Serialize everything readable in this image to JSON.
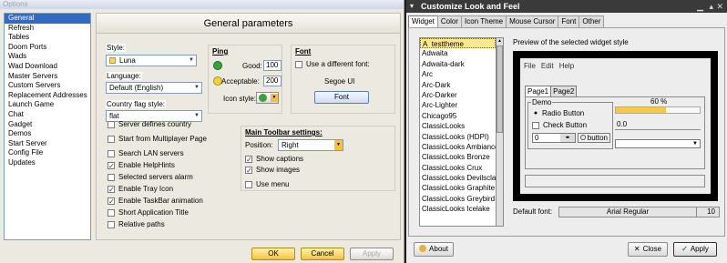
{
  "options_window": {
    "title": "Options",
    "nav_items": [
      "General",
      "Refresh",
      "Tables",
      "Doom Ports",
      "Wads",
      "Wad Download",
      "Master Servers",
      "Custom Servers",
      "Replacement Addresses",
      "Launch Game",
      "Chat",
      "Gadget",
      "Demos",
      "Start Server",
      "Config File",
      "Updates"
    ],
    "selected_nav": 0,
    "header": "General parameters",
    "style_label": "Style:",
    "style_value": "Luna",
    "language_label": "Language:",
    "language_value": "Default (English)",
    "country_flag_label": "Country flag style:",
    "country_flag_value": "flat",
    "checkboxes": [
      {
        "label": "Server defines country",
        "checked": false
      },
      {
        "label": "Start from Multiplayer Page",
        "checked": false
      },
      {
        "label": "Search LAN servers",
        "checked": false
      },
      {
        "label": "Enable HelpHints",
        "checked": true
      },
      {
        "label": "Selected servers alarm",
        "checked": false
      },
      {
        "label": "Enable Tray Icon",
        "checked": true
      },
      {
        "label": "Enable TaskBar animation",
        "checked": true
      },
      {
        "label": "Short Application Title",
        "checked": false
      },
      {
        "label": "Relative paths",
        "checked": false
      }
    ],
    "ping": {
      "title": "Ping",
      "good_label": "Good:",
      "good_value": "100",
      "acceptable_label": "Acceptable:",
      "acceptable_value": "200",
      "icon_style_label": "Icon style:"
    },
    "font": {
      "title": "Font",
      "use_different_label": "Use a different font:",
      "font_name": "Segoe UI",
      "button": "Font"
    },
    "toolbar": {
      "title": "Main Toolbar settings:",
      "position_label": "Position:",
      "position_value": "Right",
      "show_captions": "Show captions",
      "show_images": "Show images",
      "use_menu": "Use menu"
    },
    "buttons": {
      "ok": "OK",
      "cancel": "Cancel",
      "apply": "Apply"
    }
  },
  "customize_window": {
    "title": "Customize Look and Feel",
    "tabs": [
      "Widget",
      "Color",
      "Icon Theme",
      "Mouse Cursor",
      "Font",
      "Other"
    ],
    "themes": [
      "A_testtheme",
      "Adwaita",
      "Adwaita-dark",
      "Arc",
      "Arc-Dark",
      "Arc-Darker",
      "Arc-Lighter",
      "Chicago95",
      "ClassicLooks",
      "ClassicLooks (HDPI)",
      "ClassicLooks Ambiance",
      "ClassicLooks Bronze",
      "ClassicLooks Crux",
      "ClassicLooks Devilsclaw",
      "ClassicLooks Graphite",
      "ClassicLooks Greybird",
      "ClassicLooks Icelake"
    ],
    "preview_label": "Preview of the selected widget style",
    "preview": {
      "menu": [
        "File",
        "Edit",
        "Help"
      ],
      "tabs": [
        "Page1",
        "Page2"
      ],
      "demo_label": "Demo",
      "radio_label": "Radio Button",
      "check_label": "Check Button",
      "spin_value": "0",
      "button_label": "button",
      "progress_text": "60 %",
      "progress_fraction": 0.6,
      "scale_value": "0.0"
    },
    "default_font_label": "Default font:",
    "default_font_name": "Arial Regular",
    "default_font_size": "10",
    "buttons": {
      "about": "About",
      "close": "Close",
      "apply": "Apply"
    }
  }
}
